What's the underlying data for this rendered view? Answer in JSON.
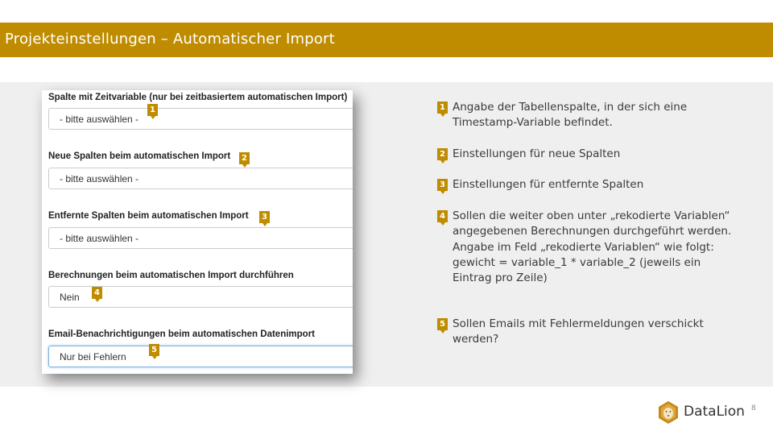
{
  "slide": {
    "title": "Projekteinstellungen – Automatischer Import",
    "page_number": "8"
  },
  "form": {
    "fields": [
      {
        "label": "Spalte mit Zeitvariable (nur bei zeitbasiertem automatischen Import)",
        "value": "- bitte auswählen -",
        "badge": "1"
      },
      {
        "label": "Neue Spalten beim automatischen Import",
        "value": "- bitte auswählen -",
        "badge": "2"
      },
      {
        "label": "Entfernte Spalten beim automatischen Import",
        "value": "- bitte auswählen -",
        "badge": "3"
      },
      {
        "label": "Berechnungen beim automatischen Import durchführen",
        "value": "Nein",
        "badge": "4"
      },
      {
        "label": "Email-Benachrichtigungen beim automatischen Datenimport",
        "value": "Nur bei Fehlern",
        "badge": "5"
      }
    ]
  },
  "notes": [
    {
      "badge": "1",
      "text": "Angabe der Tabellenspalte, in der sich eine Timestamp-Variable befindet."
    },
    {
      "badge": "2",
      "text": "Einstellungen für neue Spalten"
    },
    {
      "badge": "3",
      "text": "Einstellungen für entfernte Spalten"
    },
    {
      "badge": "4",
      "text": "Sollen die weiter oben unter „rekodierte Variablen“ angegebenen Berechnungen durchgeführt werden. Angabe im Feld „rekodierte Variablen“ wie folgt: gewicht = variable_1 * variable_2 (jeweils ein Eintrag pro Zeile)"
    },
    {
      "badge": "5",
      "text": "Sollen Emails mit Fehlermeldungen verschickt werden?"
    }
  ],
  "brand": {
    "name": "DataLion",
    "logo_icon": "lion-icon",
    "accent_color": "#bf8c00"
  }
}
